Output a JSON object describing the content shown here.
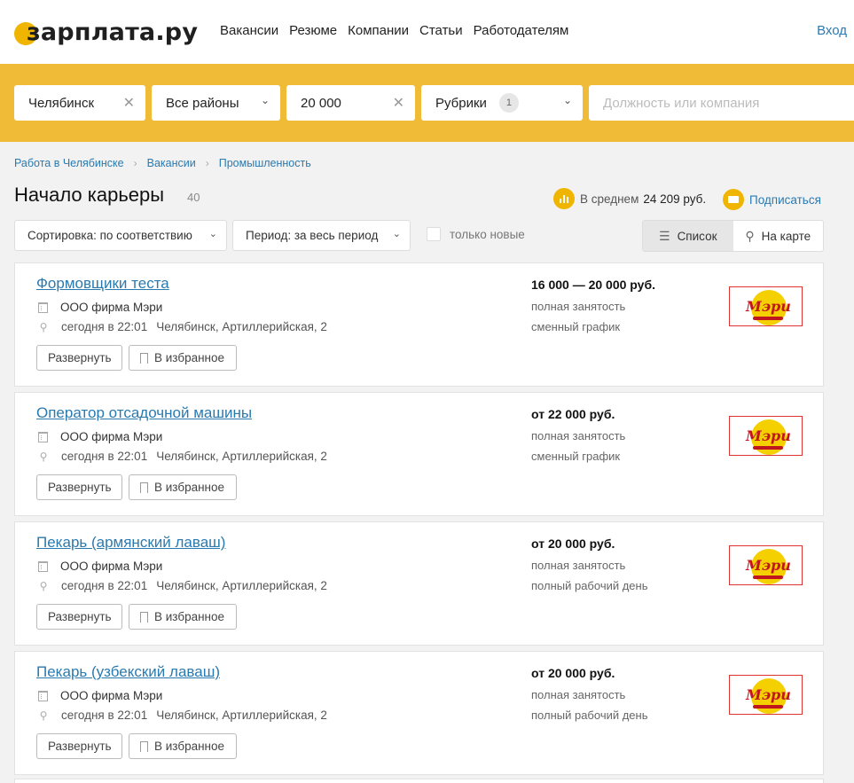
{
  "header": {
    "logo_text": "зарплата.ру",
    "nav": [
      "Вакансии",
      "Резюме",
      "Компании",
      "Статьи",
      "Работодателям"
    ],
    "login": "Вход"
  },
  "search": {
    "city": "Челябинск",
    "district": "Все районы",
    "salary": "20 000",
    "rubrics_label": "Рубрики",
    "rubrics_count": "1",
    "query_placeholder": "Должность или компания"
  },
  "breadcrumb": [
    "Работа в Челябинске",
    "Вакансии",
    "Промышленность"
  ],
  "page": {
    "title": "Начало карьеры",
    "count": "40",
    "avg_label": "В среднем",
    "avg_value": "24 209 руб.",
    "subscribe": "Подписаться"
  },
  "filters": {
    "sort": "Сортировка: по соответствию",
    "period": "Период: за весь период",
    "only_new": "только новые",
    "view_list": "Список",
    "view_map": "На карте"
  },
  "actions": {
    "expand": "Развернуть",
    "favorite": "В избранное"
  },
  "vacancies": [
    {
      "title": "Формовщики теста",
      "company": "ООО фирма Мэри",
      "time": "сегодня в 22:01",
      "address": "Челябинск, Артиллерийская, 2",
      "salary": "16 000 — 20 000 руб.",
      "employment": "полная занятость",
      "schedule": "сменный график",
      "logo_word": "Мэри"
    },
    {
      "title": "Оператор отсадочной машины",
      "company": "ООО фирма Мэри",
      "time": "сегодня в 22:01",
      "address": "Челябинск, Артиллерийская, 2",
      "salary": "от 22 000 руб.",
      "employment": "полная занятость",
      "schedule": "сменный график",
      "logo_word": "Мэри"
    },
    {
      "title": "Пекарь (армянский лаваш)",
      "company": "ООО фирма Мэри",
      "time": "сегодня в 22:01",
      "address": "Челябинск, Артиллерийская, 2",
      "salary": "от 20 000 руб.",
      "employment": "полная занятость",
      "schedule": "полный рабочий день",
      "logo_word": "Мэри"
    },
    {
      "title": "Пекарь (узбекский лаваш)",
      "company": "ООО фирма Мэри",
      "time": "сегодня в 22:01",
      "address": "Челябинск, Артиллерийская, 2",
      "salary": "от 20 000 руб.",
      "employment": "полная занятость",
      "schedule": "полный рабочий день",
      "logo_word": "Мэри"
    }
  ],
  "colors": {
    "brand_yellow": "#f0bb36",
    "link_blue": "#2a7ab0"
  }
}
